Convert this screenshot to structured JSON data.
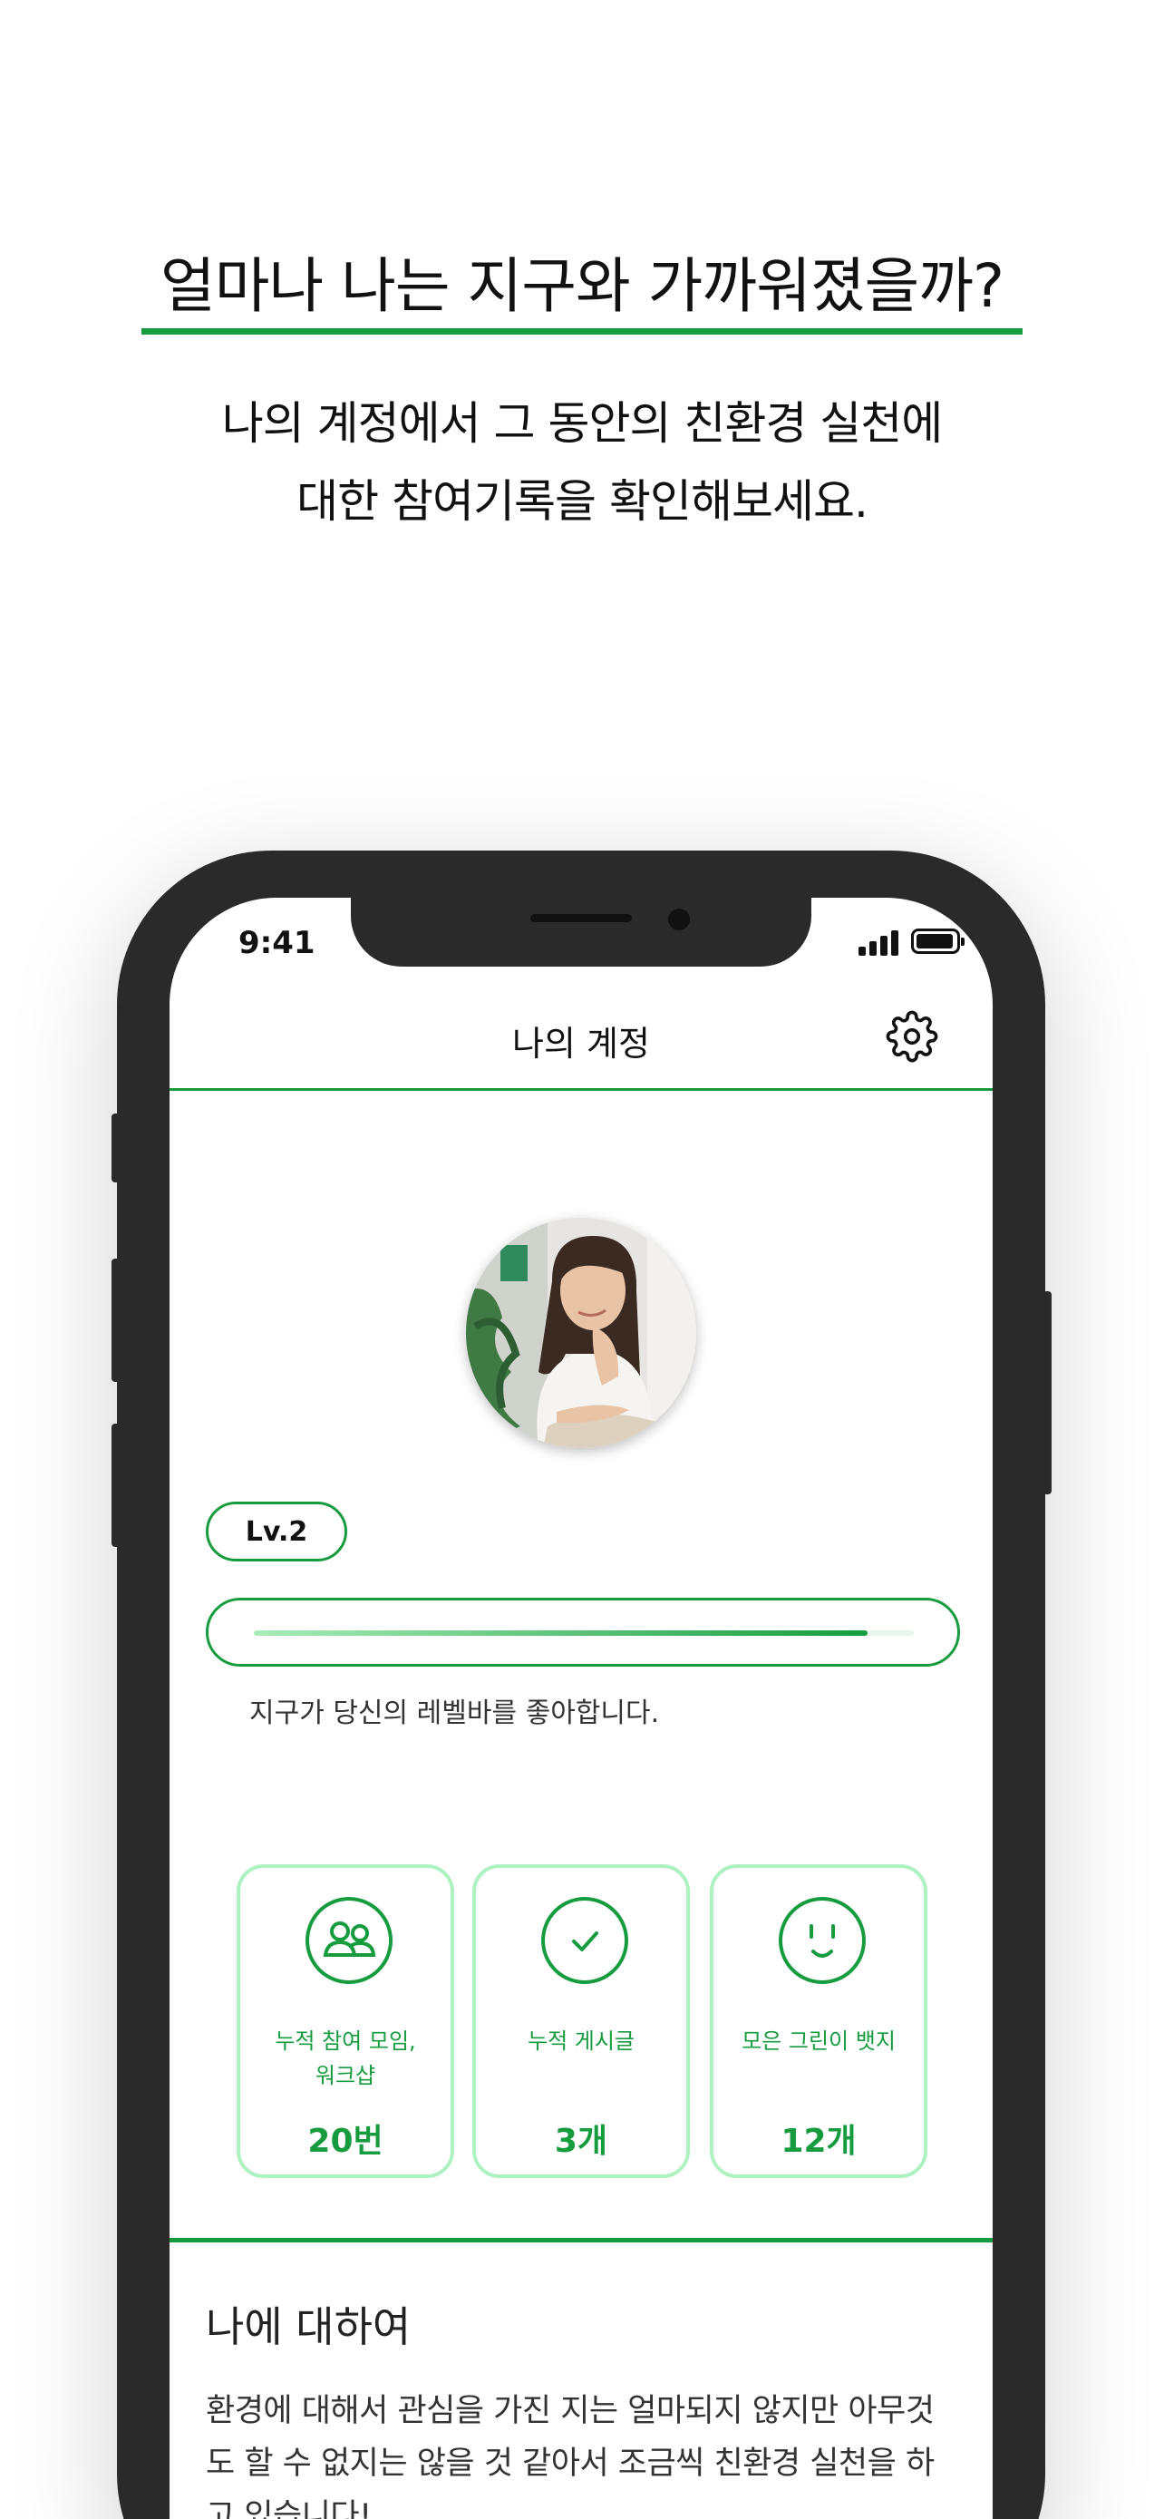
{
  "promo": {
    "headline": "얼마나 나는 지구와 가까워졌을까?",
    "subtext_line1": "나의 계정에서 그 동안의 친환경 실천에",
    "subtext_line2": "대한 참여기록을 확인해보세요."
  },
  "status_bar": {
    "time": "9:41"
  },
  "nav": {
    "title": "나의 계정",
    "settings_icon": "gear-icon"
  },
  "profile": {
    "level_label": "Lv.2",
    "level_progress": 0.93,
    "level_message": "지구가 당신의 레벨바를 좋아합니다."
  },
  "stats": [
    {
      "icon": "people-icon",
      "label_line1": "누적 참여 모임,",
      "label_line2": "워크샵",
      "value": "20번"
    },
    {
      "icon": "check-circle-icon",
      "label_line1": "누적 게시글",
      "label_line2": "",
      "value": "3개"
    },
    {
      "icon": "smile-icon",
      "label_line1": "모은 그린이 뱃지",
      "label_line2": "",
      "value": "12개"
    }
  ],
  "about": {
    "title": "나에 대하여",
    "text": "환경에 대해서 관심을 가진 지는 얼마되지 않지만 아무것도 할 수 없지는 않을 것 같아서 조금씩 친환경 실천을 하고 있습니다!"
  },
  "colors": {
    "accent": "#169c3f",
    "card_border": "#aef2c2",
    "phone_frame": "#2a2a2a"
  }
}
